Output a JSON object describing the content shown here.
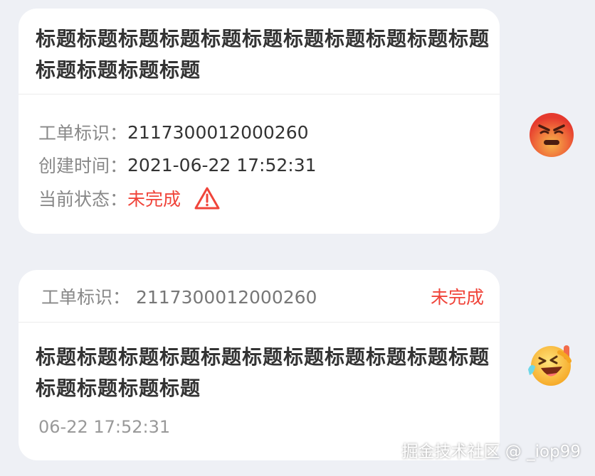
{
  "card1": {
    "title": "标题标题标题标题标题标题标题标题标题标题标题标题标题标题标题",
    "id_label": "工单标识：",
    "id_value": "2117300012000260",
    "time_label": "创建时间：",
    "time_value": "2021-06-22 17:52:31",
    "status_label": "当前状态：",
    "status_value": "未完成",
    "status_icon": "warning-triangle-icon"
  },
  "card2": {
    "id_label": "工单标识：",
    "id_value": "2117300012000260",
    "status_value": "未完成",
    "title": "标题标题标题标题标题标题标题标题标题标题标题标题标题标题标题",
    "time": "06-22 17:52:31"
  },
  "emojis": [
    "angry-face-icon",
    "laughing-face-icon"
  ],
  "watermark": "掘金技术社区 @ _iop99",
  "colors": {
    "background": "#eef0f5",
    "card": "#ffffff",
    "status_red": "#f0443a",
    "label_gray": "#888888",
    "text_dark": "#333333"
  }
}
